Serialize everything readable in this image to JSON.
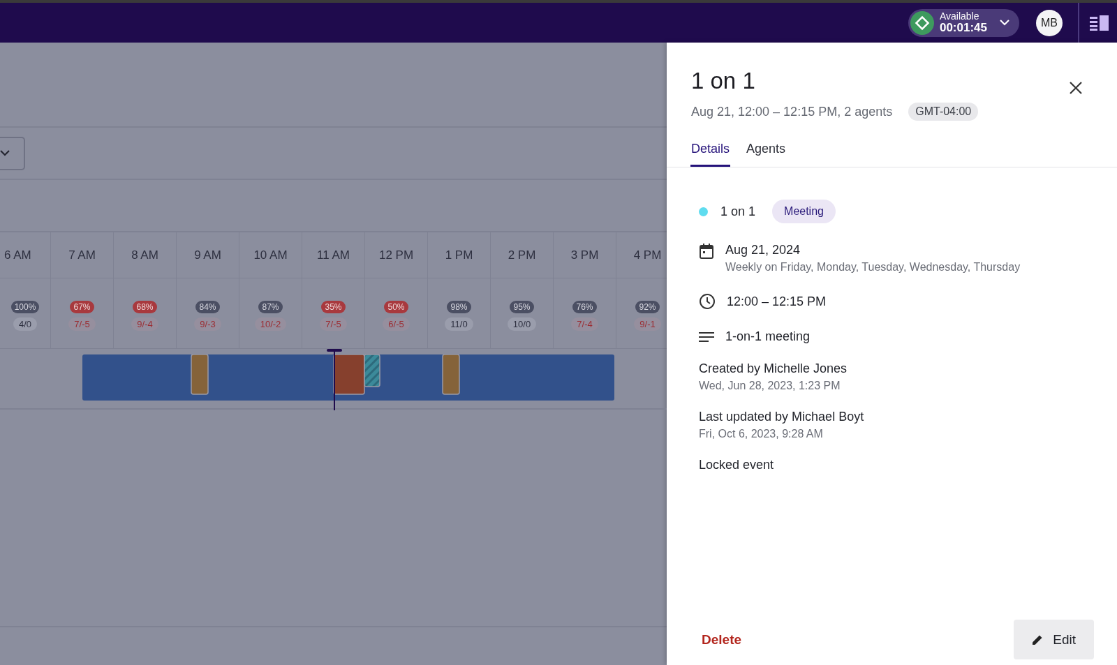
{
  "top_bar": {
    "status": {
      "label": "Available",
      "timer": "00:01:45"
    },
    "avatar": "MB"
  },
  "timeline": {
    "hours": [
      {
        "label": "6 AM",
        "coverage": "100%",
        "coverage_low": false,
        "net": "4/0",
        "net_low": false
      },
      {
        "label": "7 AM",
        "coverage": "67%",
        "coverage_low": true,
        "net": "7/-5",
        "net_low": true
      },
      {
        "label": "8 AM",
        "coverage": "68%",
        "coverage_low": true,
        "net": "9/-4",
        "net_low": true
      },
      {
        "label": "9 AM",
        "coverage": "84%",
        "coverage_low": false,
        "net": "9/-3",
        "net_low": true
      },
      {
        "label": "10 AM",
        "coverage": "87%",
        "coverage_low": false,
        "net": "10/-2",
        "net_low": true
      },
      {
        "label": "11 AM",
        "coverage": "35%",
        "coverage_low": true,
        "net": "7/-5",
        "net_low": true
      },
      {
        "label": "12 PM",
        "coverage": "50%",
        "coverage_low": true,
        "net": "6/-5",
        "net_low": true
      },
      {
        "label": "1 PM",
        "coverage": "98%",
        "coverage_low": false,
        "net": "11/0",
        "net_low": false
      },
      {
        "label": "2 PM",
        "coverage": "95%",
        "coverage_low": false,
        "net": "10/0",
        "net_low": false
      },
      {
        "label": "3 PM",
        "coverage": "76%",
        "coverage_low": false,
        "net": "7/-4",
        "net_low": true
      },
      {
        "label": "4 PM",
        "coverage": "92%",
        "coverage_low": false,
        "net": "9/-1",
        "net_low": true
      }
    ]
  },
  "panel": {
    "title": "1 on 1",
    "subtitle": "Aug 21, 12:00 – 12:15 PM, 2 agents",
    "timezone": "GMT-04:00",
    "tabs": [
      {
        "label": "Details",
        "selected": true
      },
      {
        "label": "Agents",
        "selected": false
      }
    ],
    "event": {
      "name": "1 on 1",
      "color": "#5fdcef",
      "type": "Meeting"
    },
    "date": "Aug 21, 2024",
    "recurrence": "Weekly on Friday, Monday, Tuesday, Wednesday, Thursday",
    "time": "12:00 – 12:15 PM",
    "description": "1-on-1 meeting",
    "created": {
      "label": "Created by Michelle Jones",
      "when": "Wed, Jun 28, 2023, 1:23 PM"
    },
    "updated": {
      "label": "Last updated by Michael Boyt",
      "when": "Fri, Oct 6, 2023, 9:28 AM"
    },
    "locked": "Locked event",
    "buttons": {
      "delete": "Delete",
      "edit": "Edit"
    }
  }
}
